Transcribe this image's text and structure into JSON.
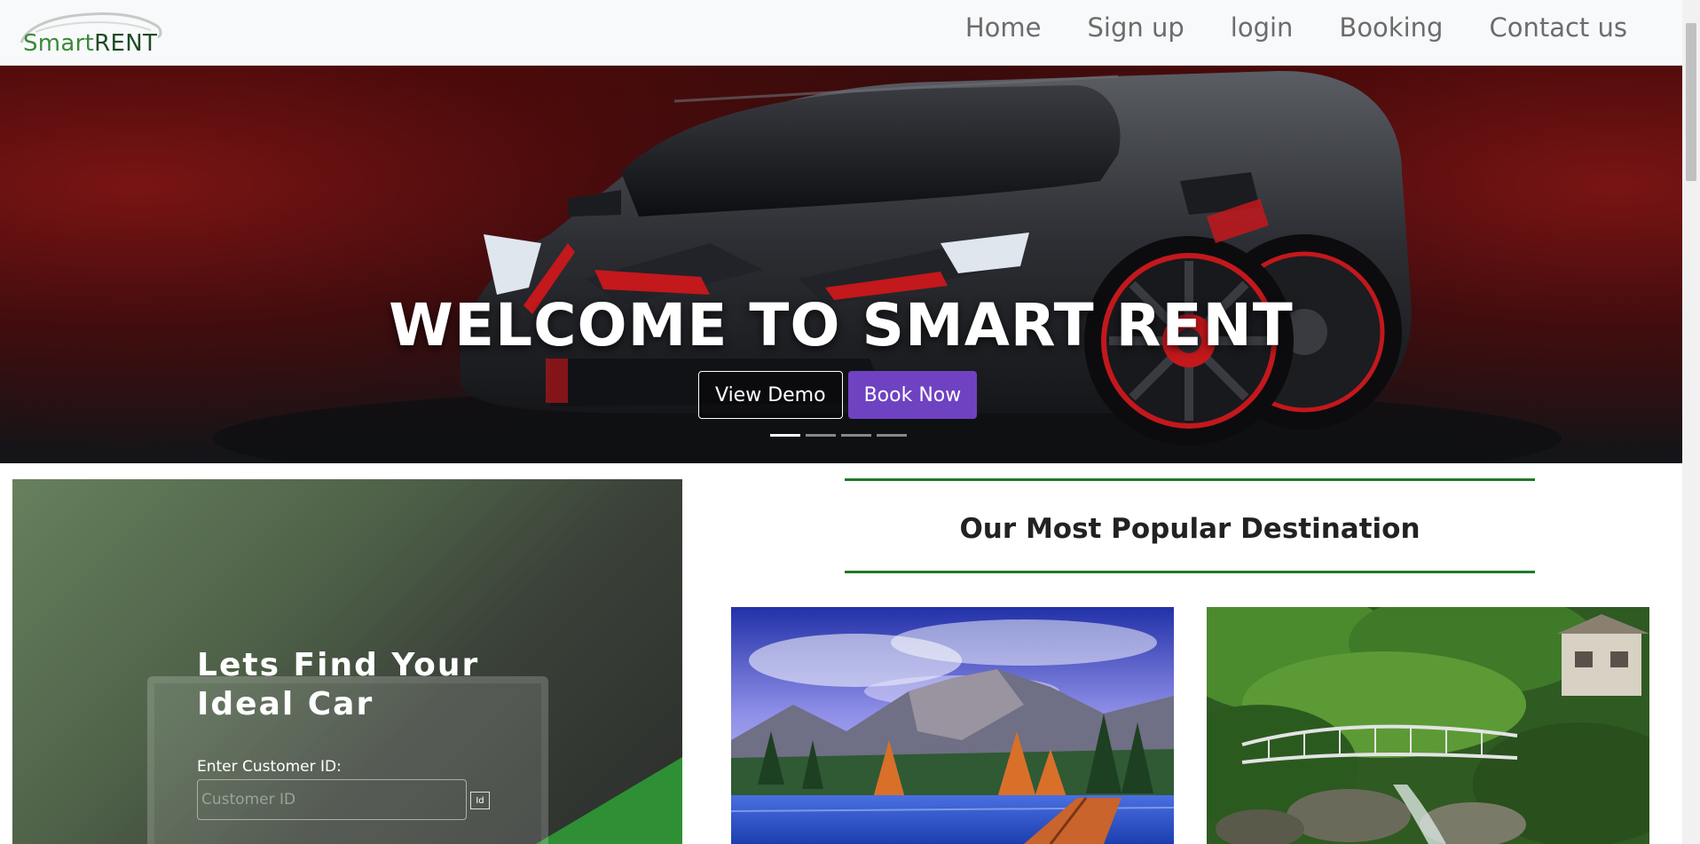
{
  "navbar": {
    "logo": {
      "part1": "Smart",
      "part2": "RENT"
    },
    "links": [
      "Home",
      "Sign up",
      "login",
      "Booking",
      "Contact us"
    ]
  },
  "hero": {
    "title": "WELCOME TO SMART RENT",
    "view_demo_label": "View Demo",
    "book_now_label": "Book Now",
    "slides": {
      "count": 4,
      "active": 1
    }
  },
  "find_car": {
    "title": "Lets Find Your Ideal Car",
    "customer_id_label": "Enter Customer ID:",
    "customer_id_placeholder": "Customer ID",
    "customer_id_value": "",
    "id_icon_text": "Id"
  },
  "destinations": {
    "title": "Our Most Popular Destination"
  },
  "colors": {
    "accent_purple": "#6f42c1",
    "rule_green": "#1f7a25",
    "logo_green": "#3a8a3a"
  }
}
